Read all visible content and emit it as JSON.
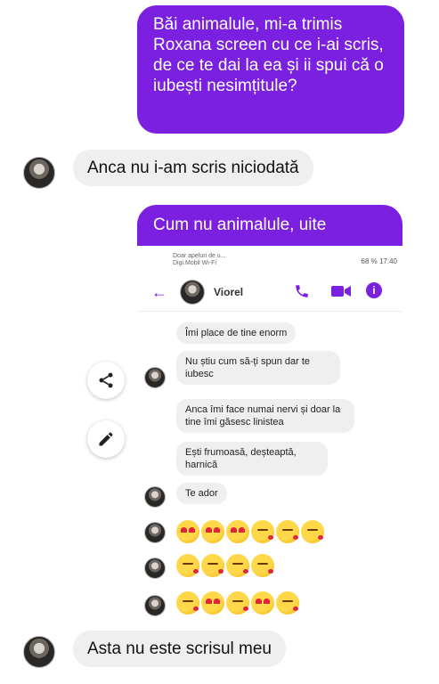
{
  "messages": {
    "out1": "Băi animalule, mi-a trimis Roxana screen cu ce i-ai scris, de ce te dai la ea și ii spui că o iubești nesimțitule?",
    "in1": "Anca nu i-am scris niciodată",
    "out2": "Cum nu animalule, uite",
    "in2": "Asta nu este scrisul meu"
  },
  "screenshot": {
    "status_carrier_line1": "Doar apeluri de u...",
    "status_carrier_line2": "Digi.Mobil Wi-Fi",
    "status_right": "68 % 17:40",
    "contact_name": "Viorel",
    "messages": [
      "Îmi place de tine enorm",
      "Nu știu cum să-ți spun dar te iubesc",
      "Anca îmi face numai nervi și doar la tine îmi găsesc linistea",
      "Ești frumoasă, deșteaptă, harnică",
      "Te ador"
    ]
  },
  "colors": {
    "accent": "#7b1fe0",
    "incoming_bubble": "#efefef"
  },
  "icons": [
    "back-arrow-icon",
    "phone-icon",
    "video-camera-icon",
    "info-icon",
    "share-icon",
    "pencil-icon"
  ],
  "emoji_rows": [
    [
      "heart-eyes",
      "heart-eyes",
      "heart-eyes",
      "kissing",
      "kissing",
      "kissing"
    ],
    [
      "kissing",
      "kissing",
      "kissing",
      "kissing"
    ],
    [
      "kissing",
      "heart-eyes",
      "kissing",
      "heart-eyes",
      "kissing"
    ]
  ]
}
